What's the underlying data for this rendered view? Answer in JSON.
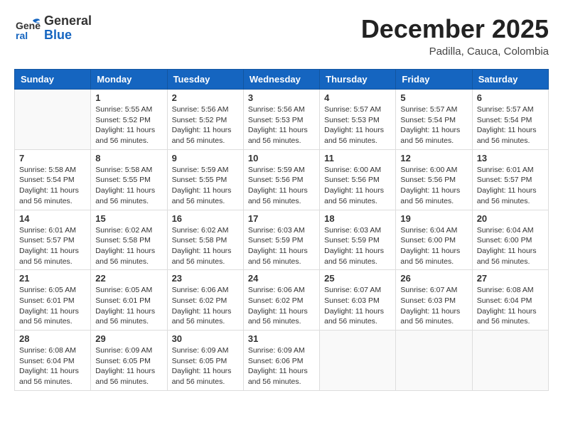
{
  "header": {
    "logo_general": "General",
    "logo_blue": "Blue",
    "month_year": "December 2025",
    "location": "Padilla, Cauca, Colombia"
  },
  "days_of_week": [
    "Sunday",
    "Monday",
    "Tuesday",
    "Wednesday",
    "Thursday",
    "Friday",
    "Saturday"
  ],
  "weeks": [
    [
      {
        "day": "",
        "info": ""
      },
      {
        "day": "1",
        "info": "Sunrise: 5:55 AM\nSunset: 5:52 PM\nDaylight: 11 hours\nand 56 minutes."
      },
      {
        "day": "2",
        "info": "Sunrise: 5:56 AM\nSunset: 5:52 PM\nDaylight: 11 hours\nand 56 minutes."
      },
      {
        "day": "3",
        "info": "Sunrise: 5:56 AM\nSunset: 5:53 PM\nDaylight: 11 hours\nand 56 minutes."
      },
      {
        "day": "4",
        "info": "Sunrise: 5:57 AM\nSunset: 5:53 PM\nDaylight: 11 hours\nand 56 minutes."
      },
      {
        "day": "5",
        "info": "Sunrise: 5:57 AM\nSunset: 5:54 PM\nDaylight: 11 hours\nand 56 minutes."
      },
      {
        "day": "6",
        "info": "Sunrise: 5:57 AM\nSunset: 5:54 PM\nDaylight: 11 hours\nand 56 minutes."
      }
    ],
    [
      {
        "day": "7",
        "info": "Sunrise: 5:58 AM\nSunset: 5:54 PM\nDaylight: 11 hours\nand 56 minutes."
      },
      {
        "day": "8",
        "info": "Sunrise: 5:58 AM\nSunset: 5:55 PM\nDaylight: 11 hours\nand 56 minutes."
      },
      {
        "day": "9",
        "info": "Sunrise: 5:59 AM\nSunset: 5:55 PM\nDaylight: 11 hours\nand 56 minutes."
      },
      {
        "day": "10",
        "info": "Sunrise: 5:59 AM\nSunset: 5:56 PM\nDaylight: 11 hours\nand 56 minutes."
      },
      {
        "day": "11",
        "info": "Sunrise: 6:00 AM\nSunset: 5:56 PM\nDaylight: 11 hours\nand 56 minutes."
      },
      {
        "day": "12",
        "info": "Sunrise: 6:00 AM\nSunset: 5:56 PM\nDaylight: 11 hours\nand 56 minutes."
      },
      {
        "day": "13",
        "info": "Sunrise: 6:01 AM\nSunset: 5:57 PM\nDaylight: 11 hours\nand 56 minutes."
      }
    ],
    [
      {
        "day": "14",
        "info": "Sunrise: 6:01 AM\nSunset: 5:57 PM\nDaylight: 11 hours\nand 56 minutes."
      },
      {
        "day": "15",
        "info": "Sunrise: 6:02 AM\nSunset: 5:58 PM\nDaylight: 11 hours\nand 56 minutes."
      },
      {
        "day": "16",
        "info": "Sunrise: 6:02 AM\nSunset: 5:58 PM\nDaylight: 11 hours\nand 56 minutes."
      },
      {
        "day": "17",
        "info": "Sunrise: 6:03 AM\nSunset: 5:59 PM\nDaylight: 11 hours\nand 56 minutes."
      },
      {
        "day": "18",
        "info": "Sunrise: 6:03 AM\nSunset: 5:59 PM\nDaylight: 11 hours\nand 56 minutes."
      },
      {
        "day": "19",
        "info": "Sunrise: 6:04 AM\nSunset: 6:00 PM\nDaylight: 11 hours\nand 56 minutes."
      },
      {
        "day": "20",
        "info": "Sunrise: 6:04 AM\nSunset: 6:00 PM\nDaylight: 11 hours\nand 56 minutes."
      }
    ],
    [
      {
        "day": "21",
        "info": "Sunrise: 6:05 AM\nSunset: 6:01 PM\nDaylight: 11 hours\nand 56 minutes."
      },
      {
        "day": "22",
        "info": "Sunrise: 6:05 AM\nSunset: 6:01 PM\nDaylight: 11 hours\nand 56 minutes."
      },
      {
        "day": "23",
        "info": "Sunrise: 6:06 AM\nSunset: 6:02 PM\nDaylight: 11 hours\nand 56 minutes."
      },
      {
        "day": "24",
        "info": "Sunrise: 6:06 AM\nSunset: 6:02 PM\nDaylight: 11 hours\nand 56 minutes."
      },
      {
        "day": "25",
        "info": "Sunrise: 6:07 AM\nSunset: 6:03 PM\nDaylight: 11 hours\nand 56 minutes."
      },
      {
        "day": "26",
        "info": "Sunrise: 6:07 AM\nSunset: 6:03 PM\nDaylight: 11 hours\nand 56 minutes."
      },
      {
        "day": "27",
        "info": "Sunrise: 6:08 AM\nSunset: 6:04 PM\nDaylight: 11 hours\nand 56 minutes."
      }
    ],
    [
      {
        "day": "28",
        "info": "Sunrise: 6:08 AM\nSunset: 6:04 PM\nDaylight: 11 hours\nand 56 minutes."
      },
      {
        "day": "29",
        "info": "Sunrise: 6:09 AM\nSunset: 6:05 PM\nDaylight: 11 hours\nand 56 minutes."
      },
      {
        "day": "30",
        "info": "Sunrise: 6:09 AM\nSunset: 6:05 PM\nDaylight: 11 hours\nand 56 minutes."
      },
      {
        "day": "31",
        "info": "Sunrise: 6:09 AM\nSunset: 6:06 PM\nDaylight: 11 hours\nand 56 minutes."
      },
      {
        "day": "",
        "info": ""
      },
      {
        "day": "",
        "info": ""
      },
      {
        "day": "",
        "info": ""
      }
    ]
  ]
}
